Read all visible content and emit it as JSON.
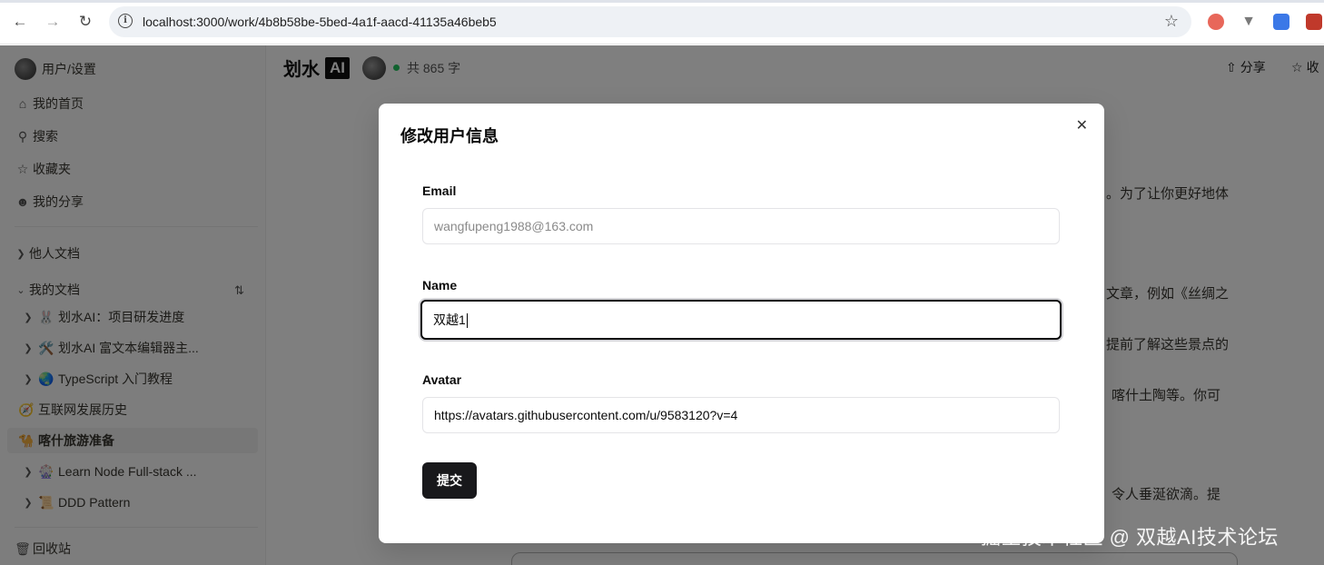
{
  "browser": {
    "url": "localhost:3000/work/4b8b58be-5bed-4a1f-aacd-41135a46beb5",
    "icons": {
      "back": "arrow-left-icon",
      "forward": "arrow-right-icon",
      "reload": "reload-icon",
      "info": "info-icon",
      "bookmark": "star-icon"
    },
    "extension_colors": [
      "#d9534f",
      "#7a7a7a",
      "#2b6de8",
      "#c0392b"
    ]
  },
  "sidebar": {
    "user_label": "用户/设置",
    "nav": [
      {
        "icon": "home-icon",
        "label": "我的首页"
      },
      {
        "icon": "search-icon",
        "label": "搜索"
      },
      {
        "icon": "star-icon",
        "label": "收藏夹"
      },
      {
        "icon": "users-icon",
        "label": "我的分享"
      }
    ],
    "others_docs": "他人文档",
    "my_docs": "我的文档",
    "docs": [
      {
        "emoji": "🐰",
        "label": "划水AI：项目研发进度",
        "nested": true
      },
      {
        "emoji": "🛠️",
        "label": "划水AI 富文本编辑器主...",
        "nested": true
      },
      {
        "emoji": "🌏",
        "label": "TypeScript 入门教程",
        "nested": true
      },
      {
        "emoji": "🧭",
        "label": "互联网发展历史",
        "nested": false
      },
      {
        "emoji": "🐪",
        "label": "喀什旅游准备",
        "nested": false,
        "active": true
      },
      {
        "emoji": "🎡",
        "label": "Learn Node Full-stack ...",
        "nested": true
      },
      {
        "emoji": "📜",
        "label": "DDD Pattern",
        "nested": true
      }
    ],
    "trash": "回收站"
  },
  "header": {
    "brand": "划水",
    "brand_badge": "AI",
    "word_count": "共 865 字",
    "share": "分享",
    "favorite": "收"
  },
  "document_fragments": [
    "。为了让你更好地体",
    "文章，例如《丝绸之",
    "提前了解这些景点的",
    "喀什土陶等。你可",
    "令人垂涎欲滴。提"
  ],
  "modal": {
    "title": "修改用户信息",
    "email_label": "Email",
    "email_placeholder": "wangfupeng1988@163.com",
    "name_label": "Name",
    "name_value": "双越1",
    "avatar_label": "Avatar",
    "avatar_value": "https://avatars.githubusercontent.com/u/9583120?v=4",
    "submit_label": "提交"
  },
  "watermark": "掘金技术社区 @ 双越AI技术论坛"
}
